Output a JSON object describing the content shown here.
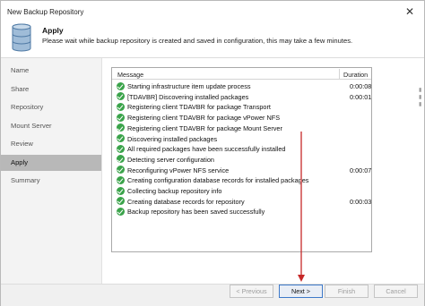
{
  "window": {
    "title": "New Backup Repository"
  },
  "header": {
    "title": "Apply",
    "subtitle": "Please wait while backup repository is created and saved in configuration, this may take a few minutes."
  },
  "sidebar": {
    "items": [
      {
        "label": "Name",
        "active": false
      },
      {
        "label": "Share",
        "active": false
      },
      {
        "label": "Repository",
        "active": false
      },
      {
        "label": "Mount Server",
        "active": false
      },
      {
        "label": "Review",
        "active": false
      },
      {
        "label": "Apply",
        "active": true
      },
      {
        "label": "Summary",
        "active": false
      }
    ]
  },
  "log": {
    "columns": {
      "message": "Message",
      "duration": "Duration"
    },
    "rows": [
      {
        "message": "Starting infrastructure item update process",
        "duration": "0:00:08",
        "status": "success"
      },
      {
        "message": "[TDAVBR] Discovering installed packages",
        "duration": "0:00:01",
        "status": "success"
      },
      {
        "message": "Registering client TDAVBR for package Transport",
        "duration": "",
        "status": "success"
      },
      {
        "message": "Registering client TDAVBR for package vPower NFS",
        "duration": "",
        "status": "success"
      },
      {
        "message": "Registering client TDAVBR for package Mount Server",
        "duration": "",
        "status": "success"
      },
      {
        "message": "Discovering installed packages",
        "duration": "",
        "status": "success"
      },
      {
        "message": "All required packages have been successfully installed",
        "duration": "",
        "status": "success"
      },
      {
        "message": "Detecting server configuration",
        "duration": "",
        "status": "success"
      },
      {
        "message": "Reconfiguring vPower NFS service",
        "duration": "0:00:07",
        "status": "success"
      },
      {
        "message": "Creating configuration database records for installed packages",
        "duration": "",
        "status": "success"
      },
      {
        "message": "Collecting backup repository info",
        "duration": "",
        "status": "success"
      },
      {
        "message": "Creating database records for repository",
        "duration": "0:00:03",
        "status": "success"
      },
      {
        "message": "Backup repository has been saved successfully",
        "duration": "",
        "status": "success"
      }
    ]
  },
  "footer": {
    "previous": "< Previous",
    "next": "Next >",
    "finish": "Finish",
    "cancel": "Cancel"
  },
  "colors": {
    "success": "#3aa34a",
    "annotation_arrow": "#c62828",
    "active_step": "#b8b8b8",
    "primary_border": "#3d79c9"
  }
}
